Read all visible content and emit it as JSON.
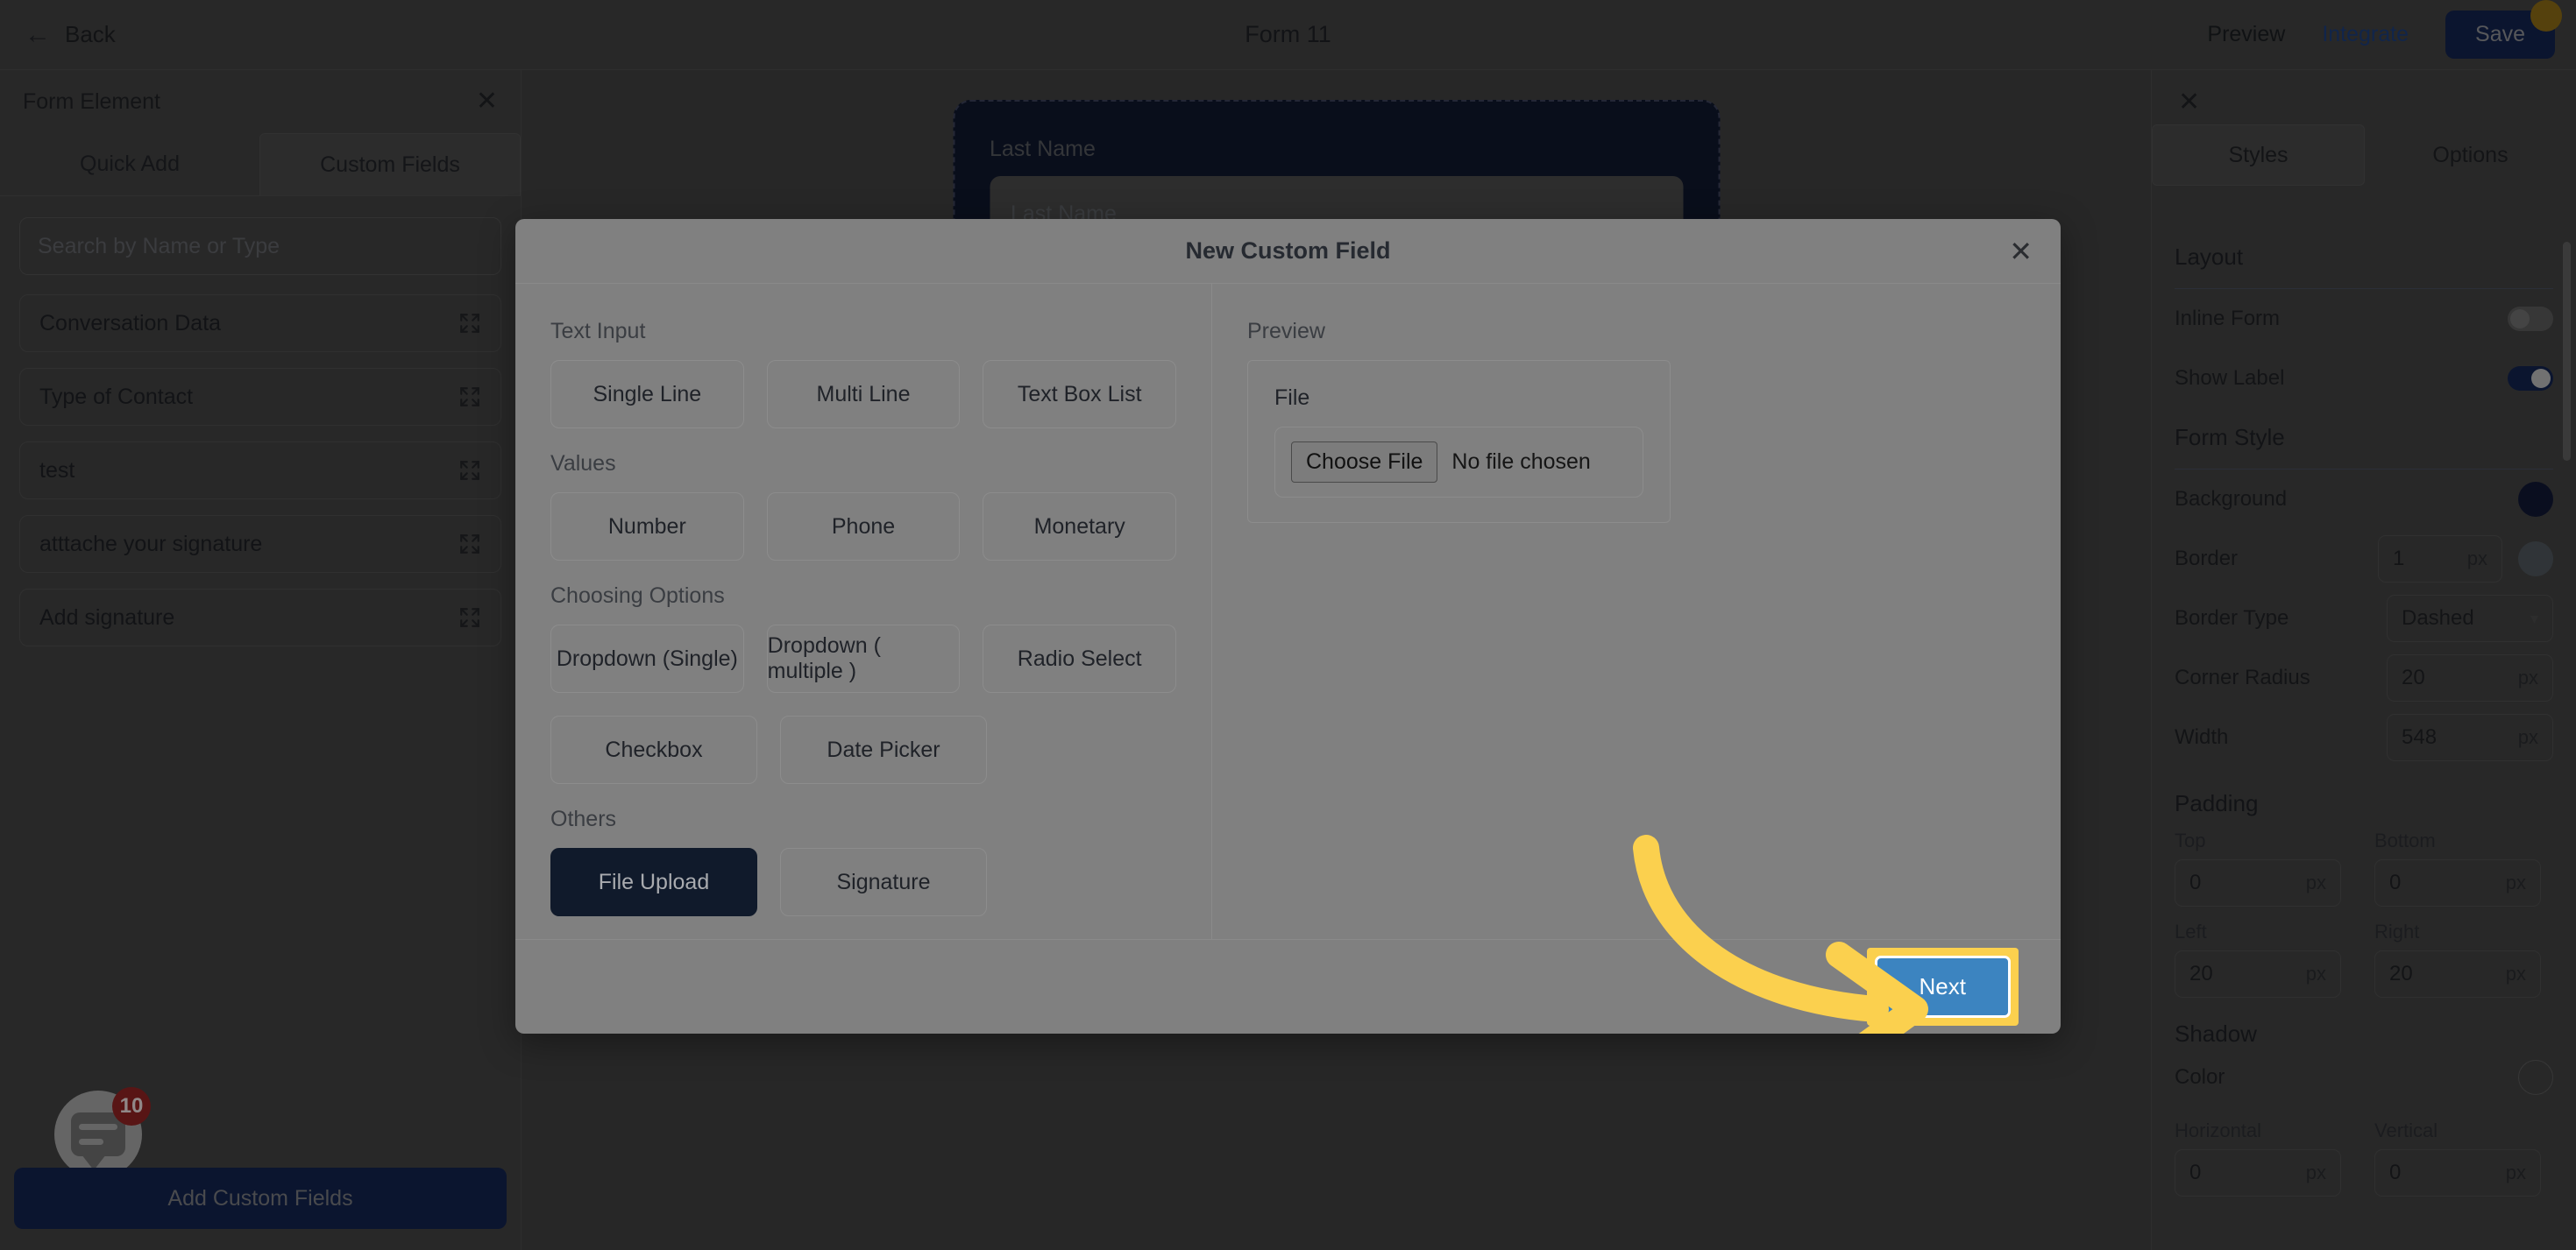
{
  "topbar": {
    "back_label": "Back",
    "form_title": "Form 11",
    "preview_label": "Preview",
    "integrate_label": "Integrate",
    "save_label": "Save"
  },
  "left_panel": {
    "title": "Form Element",
    "close_icon": "close-icon",
    "tabs": [
      {
        "label": "Quick Add",
        "active": false
      },
      {
        "label": "Custom Fields",
        "active": true
      }
    ],
    "search_placeholder": "Search by Name or Type",
    "fields": [
      {
        "label": "Conversation Data"
      },
      {
        "label": "Type of Contact"
      },
      {
        "label": "test"
      },
      {
        "label": "atttache your signature"
      },
      {
        "label": "Add signature"
      }
    ],
    "add_custom_fields_label": "Add Custom Fields",
    "chat_badge_count": "10"
  },
  "canvas": {
    "field_label": "Last Name",
    "field_placeholder": "Last Name"
  },
  "right_panel": {
    "close_icon": "close-icon",
    "tabs": [
      {
        "label": "Styles",
        "active": true
      },
      {
        "label": "Options",
        "active": false
      }
    ],
    "layout_title": "Layout",
    "inline_form_label": "Inline Form",
    "inline_form_value": "off",
    "show_label_label": "Show Label",
    "show_label_value": "on",
    "form_style_title": "Form Style",
    "background_label": "Background",
    "background_color": "#111833",
    "border_label": "Border",
    "border_value": "1",
    "border_unit": "px",
    "border_color": "#4e555b",
    "border_type_label": "Border Type",
    "border_type_value": "Dashed",
    "corner_radius_label": "Corner Radius",
    "corner_radius_value": "20",
    "corner_radius_unit": "px",
    "width_label": "Width",
    "width_value": "548",
    "width_unit": "px",
    "padding_title": "Padding",
    "padding": {
      "top_label": "Top",
      "top_value": "0",
      "top_unit": "px",
      "bottom_label": "Bottom",
      "bottom_value": "0",
      "bottom_unit": "px",
      "left_label": "Left",
      "left_value": "20",
      "left_unit": "px",
      "right_label": "Right",
      "right_value": "20",
      "right_unit": "px"
    },
    "shadow_title": "Shadow",
    "shadow_color_label": "Color",
    "shadow_horizontal_label": "Horizontal",
    "shadow_horizontal_value": "0",
    "shadow_horizontal_unit": "px",
    "shadow_vertical_label": "Vertical",
    "shadow_vertical_value": "0",
    "shadow_vertical_unit": "px"
  },
  "modal": {
    "title": "New Custom Field",
    "close_icon": "close-icon",
    "groups": [
      {
        "label": "Text Input",
        "rows": [
          [
            {
              "label": "Single Line",
              "selected": false
            },
            {
              "label": "Multi Line",
              "selected": false
            },
            {
              "label": "Text Box List",
              "selected": false
            }
          ]
        ]
      },
      {
        "label": "Values",
        "rows": [
          [
            {
              "label": "Number",
              "selected": false
            },
            {
              "label": "Phone",
              "selected": false
            },
            {
              "label": "Monetary",
              "selected": false
            }
          ]
        ]
      },
      {
        "label": "Choosing Options",
        "rows": [
          [
            {
              "label": "Dropdown (Single)",
              "selected": false
            },
            {
              "label": "Dropdown ( multiple )",
              "selected": false
            },
            {
              "label": "Radio Select",
              "selected": false
            }
          ],
          [
            {
              "label": "Checkbox",
              "selected": false
            },
            {
              "label": "Date Picker",
              "selected": false
            }
          ]
        ]
      },
      {
        "label": "Others",
        "rows": [
          [
            {
              "label": "File Upload",
              "selected": true
            },
            {
              "label": "Signature",
              "selected": false
            }
          ]
        ]
      }
    ],
    "preview_label": "Preview",
    "preview_field_label": "File",
    "choose_file_label": "Choose File",
    "no_file_label": "No file chosen",
    "next_label": "Next"
  },
  "annotation": {
    "arrow_color": "#fbd04e",
    "highlight_color": "#fbd04e"
  }
}
